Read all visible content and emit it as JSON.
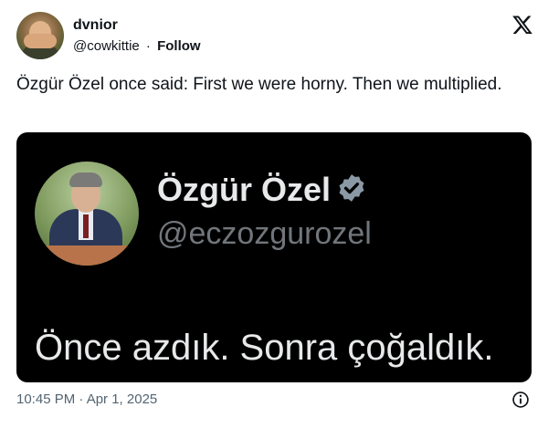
{
  "author": {
    "name": "dvnior",
    "handle": "@cowkittie",
    "separator": "·",
    "follow_label": "Follow"
  },
  "platform_icon": "x-logo-icon",
  "tweet": {
    "text": "Özgür Özel once said: First we were horny. Then we multiplied."
  },
  "media": {
    "name": "Özgür Özel",
    "verified_icon": "verified-badge-icon",
    "handle": "@eczozgurozel",
    "quote": "Önce azdık. Sonra çoğaldık."
  },
  "footer": {
    "timestamp": "10:45 PM · Apr 1, 2025",
    "info_icon": "info-icon"
  },
  "colors": {
    "text": "#0f1419",
    "secondary": "#536471",
    "media_bg": "#000000",
    "media_text": "#e7e9ea",
    "media_handle": "#71767b",
    "badge": "#8b98a5"
  }
}
